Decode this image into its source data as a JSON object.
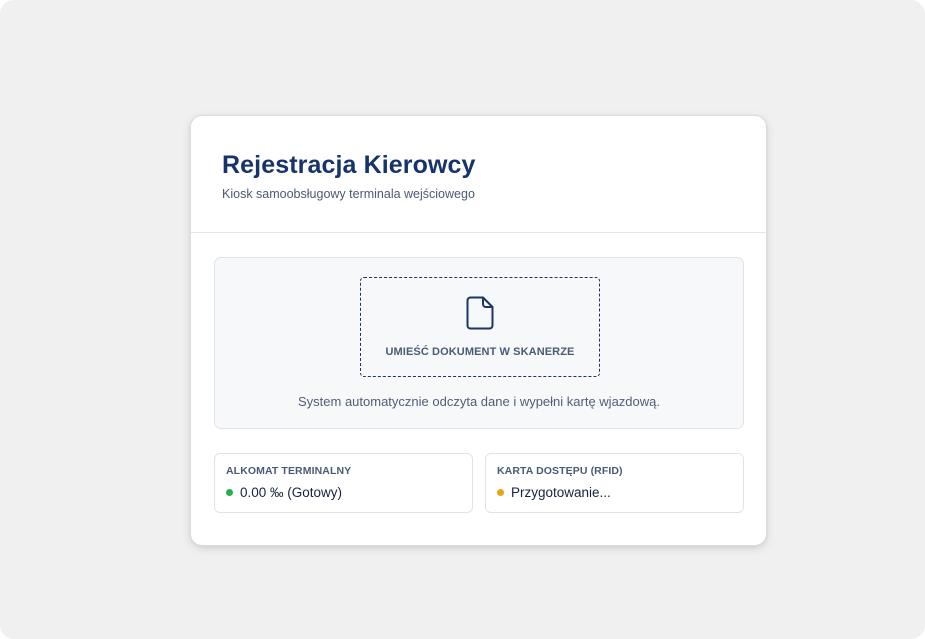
{
  "header": {
    "title": "Rejestracja Kierowcy",
    "subtitle": "Kiosk samoobsługowy terminala wejściowego"
  },
  "scanner": {
    "icon": "document-icon",
    "label": "UMIEŚĆ DOKUMENT W SKANERZE",
    "hint": "System automatycznie odczyta dane i wypełni kartę wjazdową."
  },
  "status": {
    "breathalyzer": {
      "label": "ALKOMAT TERMINALNY",
      "value": "0.00 ‰ (Gotowy)",
      "indicator_color": "#22b14c"
    },
    "rfid": {
      "label": "KARTA DOSTĘPU (RFID)",
      "value": "Przygotowanie...",
      "indicator_color": "#e8a317"
    }
  },
  "colors": {
    "accent": "#16336b",
    "background": "#f0f0f0"
  }
}
